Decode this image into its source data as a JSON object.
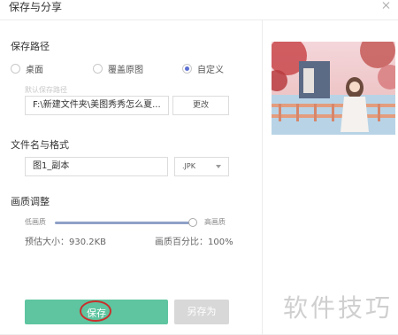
{
  "dialog": {
    "title": "保存与分享",
    "close_icon": "close-icon"
  },
  "save_path": {
    "section_title": "保存路径",
    "options": [
      {
        "label": "桌面",
        "selected": false
      },
      {
        "label": "覆盖原图",
        "selected": false
      },
      {
        "label": "自定义",
        "selected": true
      }
    ],
    "default_path_hint": "默认保存路径",
    "path_value": "F:\\新建文件夹\\美图秀秀怎么夏...",
    "change_button": "更改"
  },
  "file_name_format": {
    "section_title": "文件名与格式",
    "file_name": "图1_副本",
    "format_value": ".JPK"
  },
  "quality": {
    "section_title": "画质调整",
    "low_label": "低画质",
    "high_label": "高画质",
    "slider_value_percent": 100,
    "estimated_size": "预估大小：930.2KB",
    "quality_percent": "画质百分比：100%"
  },
  "actions": {
    "save": "保存",
    "save_as": "另存为"
  },
  "watermark": "软件技巧",
  "colors": {
    "primary_green": "#5ec5a0",
    "highlight_red": "#c9302c",
    "radio_selected": "#5d6fd1"
  }
}
